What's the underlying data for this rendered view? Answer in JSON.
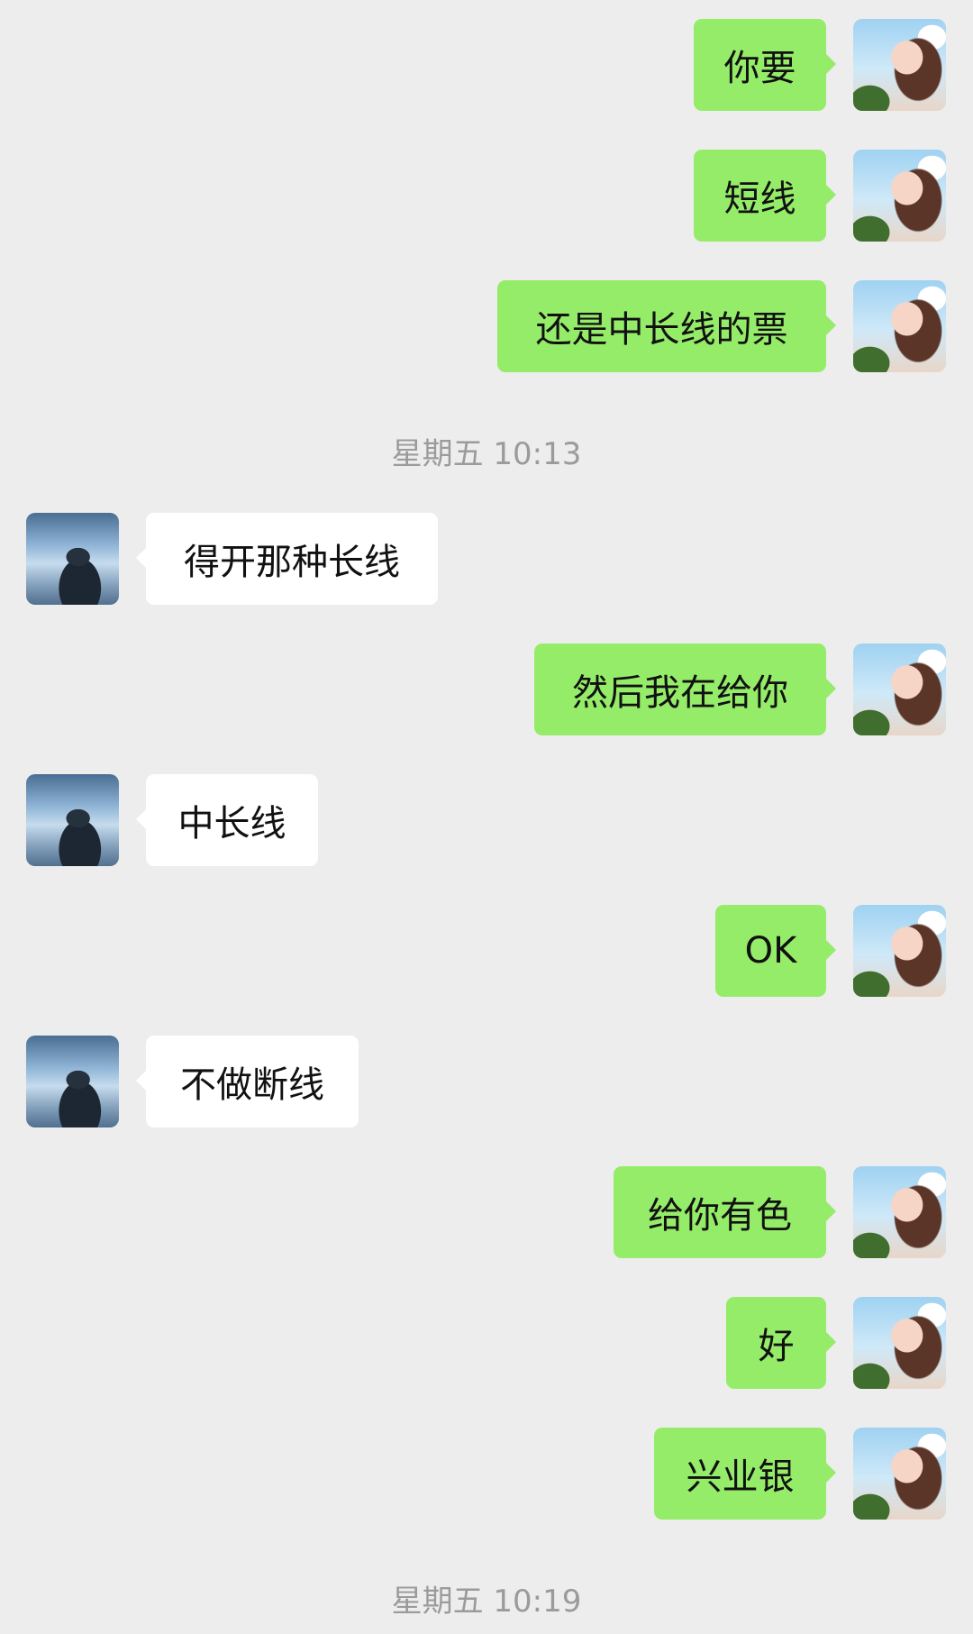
{
  "messages": [
    {
      "side": "out",
      "text": "你要"
    },
    {
      "side": "out",
      "text": "短线"
    },
    {
      "side": "out",
      "text": "还是中长线的票"
    },
    {
      "side": "in",
      "text": "得开那种长线"
    },
    {
      "side": "out",
      "text": "然后我在给你"
    },
    {
      "side": "in",
      "text": "中长线"
    },
    {
      "side": "out",
      "text": "OK"
    },
    {
      "side": "in",
      "text": "不做断线"
    },
    {
      "side": "out",
      "text": "给你有色"
    },
    {
      "side": "out",
      "text": "好"
    },
    {
      "side": "out",
      "text": "兴业银"
    }
  ],
  "timestamps": [
    "星期五 10:13",
    "星期五 10:19"
  ],
  "colors": {
    "background": "#ededed",
    "outgoing_bubble": "#95ec69",
    "incoming_bubble": "#ffffff",
    "timestamp_text": "#9b9b9b"
  }
}
